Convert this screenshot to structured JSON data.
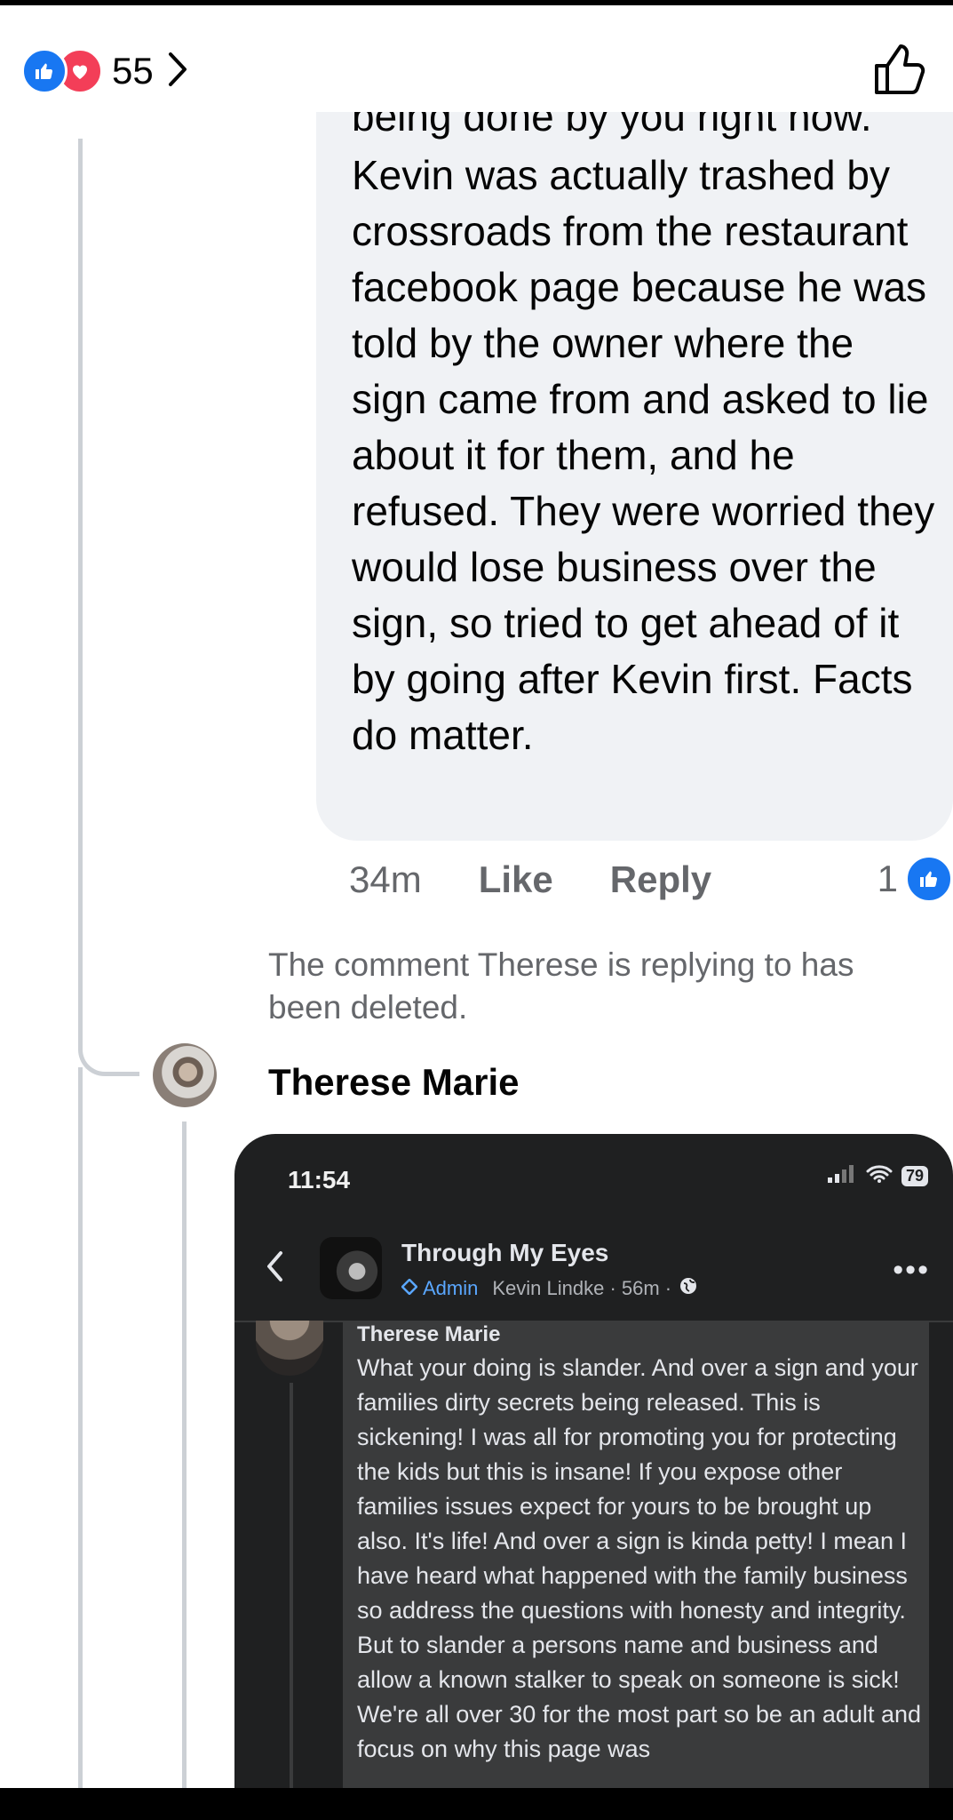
{
  "top_bar": {
    "reaction_count": "55",
    "reaction_icons": [
      "like-icon",
      "love-icon"
    ],
    "like_icon": "thumbs-up-outline-icon"
  },
  "comment": {
    "cut_line": "being done by you right now.",
    "text": "Kevin was actually trashed by crossroads from the restaurant facebook page because he was told by the owner where the sign came from and asked to lie about it for them, and he refused. They were worried they would lose business over the sign, so tried to get ahead of it by going after Kevin first. Facts do matter.",
    "time": "34m",
    "like_label": "Like",
    "reply_label": "Reply",
    "reaction_count": "1"
  },
  "deleted_notice": "The comment Therese is replying to has been deleted.",
  "reply": {
    "author": "Therese Marie",
    "screenshot": {
      "status_time": "11:54",
      "battery": "79",
      "group_name": "Through My Eyes",
      "admin_label": "Admin",
      "byline": "Kevin Lindke · 56m ·",
      "inner_author": "Therese Marie",
      "inner_text": "What your doing is slander. And over a sign and your families dirty secrets being released. This is sickening! I was all for promoting you for protecting the kids but this is insane! If you expose other families issues expect for yours to be brought up also. It's life! And over a sign is kinda petty! I mean I have heard what happened with the family business so address the questions with honesty and integrity. But to slander a persons name and business and allow a known stalker to speak on someone is sick! We're all over 30 for the most part so be an adult and focus on why this page was"
    }
  },
  "colors": {
    "facebook_blue": "#1877f2",
    "love_red": "#f33e58",
    "bubble_gray": "#f0f2f5",
    "meta_gray": "#65676b",
    "dark_card": "#1f2021"
  }
}
